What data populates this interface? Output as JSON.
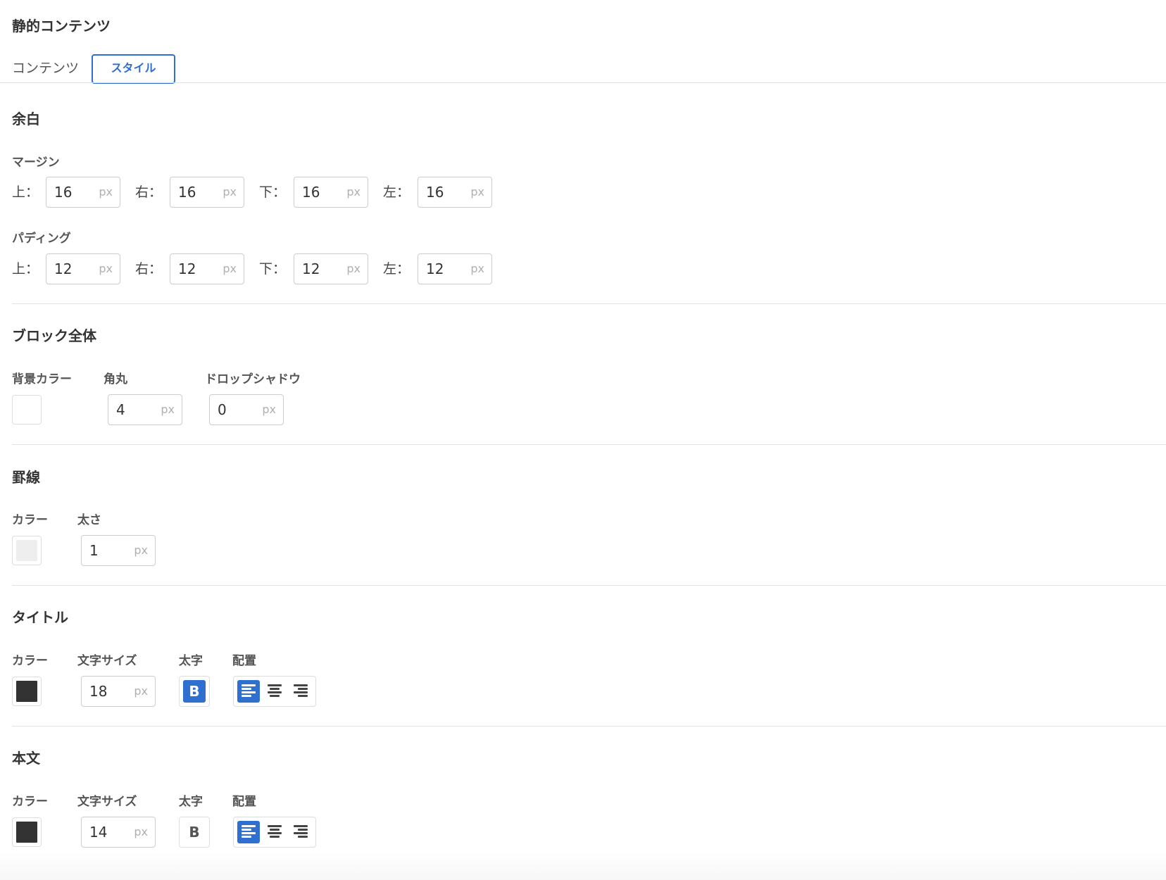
{
  "panel": {
    "title": "静的コンテンツ"
  },
  "tabs": [
    {
      "label": "コンテンツ",
      "active": false
    },
    {
      "label": "スタイル",
      "active": true
    }
  ],
  "spacing": {
    "title": "余白",
    "margin": {
      "label": "マージン",
      "top_label": "上：",
      "right_label": "右：",
      "bottom_label": "下：",
      "left_label": "左：",
      "top": "16",
      "right": "16",
      "bottom": "16",
      "left": "16"
    },
    "padding": {
      "label": "パディング",
      "top_label": "上：",
      "right_label": "右：",
      "bottom_label": "下：",
      "left_label": "左：",
      "top": "12",
      "right": "12",
      "bottom": "12",
      "left": "12"
    }
  },
  "block": {
    "title": "ブロック全体",
    "bg_label": "背景カラー",
    "bg_color": "#ffffff",
    "radius_label": "角丸",
    "radius": "4",
    "shadow_label": "ドロップシャドウ",
    "shadow": "0"
  },
  "border": {
    "title": "罫線",
    "color_label": "カラー",
    "color": "#eeeeee",
    "width_label": "太さ",
    "width": "1"
  },
  "title_style": {
    "title": "タイトル",
    "color_label": "カラー",
    "color": "#333333",
    "size_label": "文字サイズ",
    "size": "18",
    "bold_label": "太字",
    "bold": true,
    "align_label": "配置",
    "align": "left"
  },
  "body_style": {
    "title": "本文",
    "color_label": "カラー",
    "color": "#333333",
    "size_label": "文字サイズ",
    "size": "14",
    "bold_label": "太字",
    "bold": false,
    "align_label": "配置",
    "align": "left"
  },
  "common": {
    "unit": "px",
    "bold_glyph": "B",
    "accent": "#2f6fd0"
  }
}
